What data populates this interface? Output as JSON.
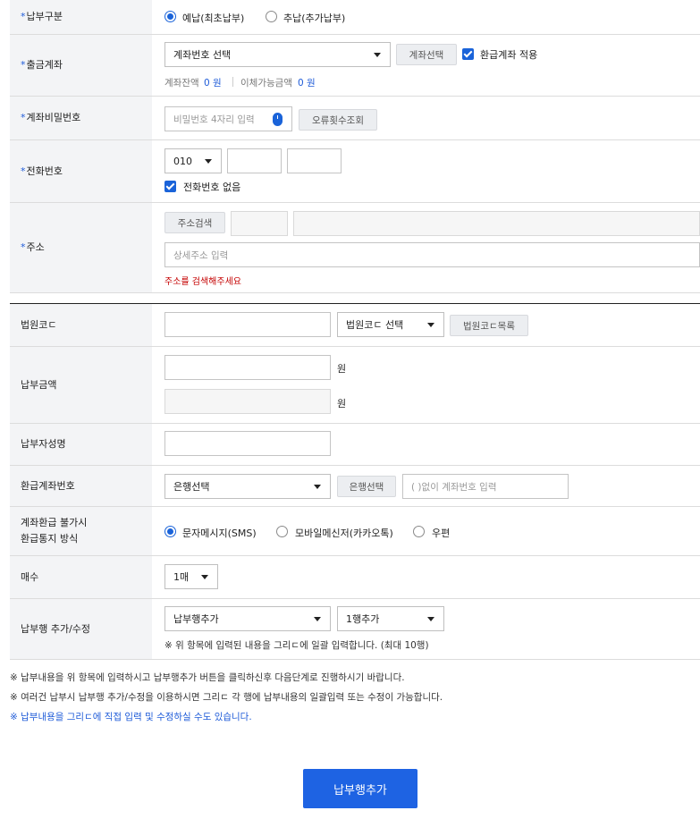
{
  "payment_type": {
    "label": "납부구분",
    "options": [
      "예납(최초납부)",
      "추납(추가납부)"
    ]
  },
  "withdraw_account": {
    "label": "출금계좌",
    "select_value": "계좌번호 선택",
    "select_button": "계좌선택",
    "refund_apply_label": "환급계좌 적용",
    "balance_label": "계좌잔액",
    "balance_value": "0 원",
    "transferable_label": "이체가능금액",
    "transferable_value": "0 원"
  },
  "account_password": {
    "label": "계좌비밀번호",
    "placeholder": "비밀번호 4자리 입력",
    "error_count_button": "오류횟수조회"
  },
  "phone": {
    "label": "전화번호",
    "prefix": "010",
    "no_phone_label": "전화번호 없음"
  },
  "address": {
    "label": "주소",
    "search_button": "주소검색",
    "detail_placeholder": "상세주소 입력",
    "warning": "주소를 검색해주세요"
  },
  "court_code": {
    "label": "법원코ㄷ",
    "select_value": "법원코ㄷ 선택",
    "list_button": "법원코ㄷ목록"
  },
  "payment_amount": {
    "label": "납부금액",
    "unit1": "원",
    "unit2": "원"
  },
  "payer_name": {
    "label": "납부자성명"
  },
  "refund_account": {
    "label": "환급계좌번호",
    "bank_select": "은행선택",
    "bank_button": "은행선택",
    "account_placeholder": "( )없이 계좌번호 입력"
  },
  "refund_notice": {
    "label_line1": "계좌환급 불가시",
    "label_line2": "환급통지 방식",
    "options": [
      "문자메시지(SMS)",
      "모바일메신저(카카오톡)",
      "우편"
    ]
  },
  "count": {
    "label": "매수",
    "value": "1매"
  },
  "rows_edit": {
    "label": "납부행 추가/수정",
    "select1": "납부행추가",
    "select2": "1행추가",
    "note": "※ 위 항목에 입력된 내용을 그리ㄷ에 일괄 입력합니다. (최대 10행)"
  },
  "notes": [
    "※ 납부내용을 위 항목에 입력하시고 납부행추가 버튼을 클릭하신후 다음단계로 진행하시기 바랍니다.",
    "※ 여러건 납부시 납부행 추가/수정을 이용하시면 그리ㄷ 각 행에 납부내용의 일괄입력 또는 수정이 가능합니다.",
    "※ 납부내용을 그리ㄷ에 직접 입력 및 수정하실 수도 있습니다."
  ],
  "submit_button": "납부행추가",
  "colors": {
    "accent": "#1e63e3",
    "label_bg": "#f3f4f6",
    "warning": "#c40000"
  }
}
